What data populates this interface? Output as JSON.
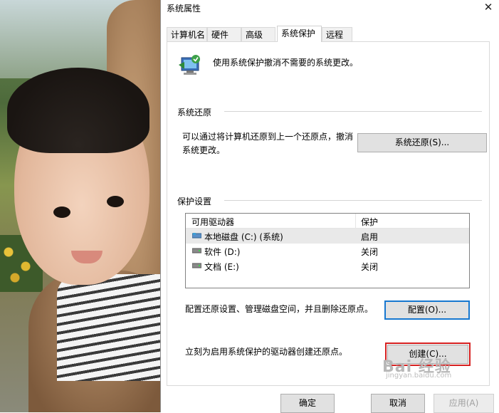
{
  "window": {
    "title": "系统属性",
    "close_glyph": "✕"
  },
  "tabs": [
    {
      "label": "计算机名"
    },
    {
      "label": "硬件"
    },
    {
      "label": "高级"
    },
    {
      "label": "系统保护",
      "active": true
    },
    {
      "label": "远程"
    }
  ],
  "intro_text": "使用系统保护撤消不需要的系统更改。",
  "restore_section": {
    "label": "系统还原",
    "description": "可以通过将计算机还原到上一个还原点，撤消系统更改。",
    "button": "系统还原(S)..."
  },
  "protection_section": {
    "label": "保护设置",
    "columns": [
      "可用驱动器",
      "保护"
    ],
    "drives": [
      {
        "name": "本地磁盘 (C:) (系统)",
        "status": "启用",
        "icon": "system-drive-icon",
        "selected": true
      },
      {
        "name": "软件 (D:)",
        "status": "关闭",
        "icon": "drive-icon"
      },
      {
        "name": "文档 (E:)",
        "status": "关闭",
        "icon": "drive-icon"
      }
    ],
    "configure_text": "配置还原设置、管理磁盘空间，并且删除还原点。",
    "configure_button": "配置(O)...",
    "create_text": "立刻为启用系统保护的驱动器创建还原点。",
    "create_button": "创建(C)..."
  },
  "footer": {
    "ok": "确定",
    "cancel": "取消",
    "apply": "应用(A)"
  },
  "watermark": {
    "main": "Bai 经验",
    "sub": "jingyan.baidu.com"
  },
  "colors": {
    "accent": "#1778d0",
    "highlight_box": "#d62020"
  }
}
